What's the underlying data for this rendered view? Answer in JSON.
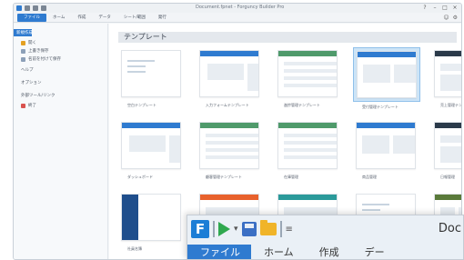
{
  "window": {
    "title": "Document.fpnet - Forguncy Builder Pro",
    "controls": [
      "?",
      "–",
      "□",
      "×"
    ]
  },
  "ribbon": {
    "tabs": [
      "ファイル",
      "ホーム",
      "作成",
      "データ",
      "シート/範囲",
      "発行"
    ]
  },
  "sidebar": {
    "items": [
      {
        "label": "新規作成",
        "icon": "new-icon",
        "active": true
      },
      {
        "label": "開く",
        "icon": "open-folder-icon"
      },
      {
        "label": "上書き保存",
        "icon": "save-icon"
      },
      {
        "label": "名前を付けて保存",
        "icon": "save-as-icon"
      },
      {
        "label": "ヘルプ",
        "icon": ""
      },
      {
        "label": "オプション",
        "icon": ""
      },
      {
        "label": "外部ツール/リンク",
        "icon": ""
      },
      {
        "label": "終了",
        "icon": "exit-icon"
      }
    ]
  },
  "main": {
    "section_title": "テンプレート",
    "templates": [
      {
        "label": "空白テンプレート",
        "theme": "blank"
      },
      {
        "label": "入力フォームテンプレート",
        "theme": "form"
      },
      {
        "label": "進捗管理テンプレート",
        "theme": "grid"
      },
      {
        "label": "受付管理テンプレート",
        "theme": "blue",
        "selected": true
      },
      {
        "label": "売上管理テンプレート",
        "theme": "dark"
      },
      {
        "label": "ダッシュボード",
        "theme": "form"
      },
      {
        "label": "顧客管理テンプレート",
        "theme": "grid"
      },
      {
        "label": "在庫管理",
        "theme": "grid"
      },
      {
        "label": "商品管理",
        "theme": "blue"
      },
      {
        "label": "日報管理",
        "theme": "dark"
      },
      {
        "label": "社員名簿",
        "theme": "navy"
      },
      {
        "label": "出張申請",
        "theme": "orange"
      },
      {
        "label": "",
        "theme": "teal"
      },
      {
        "label": "",
        "theme": "blank"
      },
      {
        "label": "",
        "theme": "green"
      }
    ]
  },
  "overlay": {
    "logo": "F",
    "title": "Doc",
    "tabs": [
      "ファイル",
      "ホーム",
      "作成",
      "デー"
    ]
  },
  "colors": {
    "accent": "#2f7bd0",
    "selected_bg": "#cde4f7"
  }
}
